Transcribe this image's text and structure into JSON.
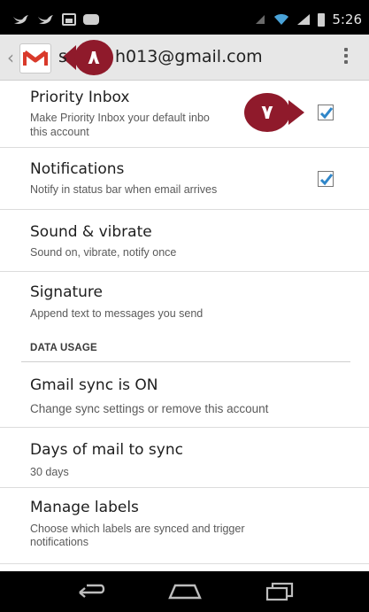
{
  "status_bar": {
    "time": "5:26",
    "icons": [
      "twitter-icon",
      "twitter-icon",
      "image-icon",
      "chat-icon",
      "signal-dim-icon",
      "wifi-icon",
      "cell-signal-icon",
      "battery-icon"
    ]
  },
  "header": {
    "account": "h013@gmail.com",
    "account_prefix": "s",
    "logo_letter": "M",
    "overflow_icon": "overflow-menu-icon"
  },
  "settings": {
    "priority_inbox": {
      "title": "Priority Inbox",
      "line1": "Make Priority Inbox your default inbo",
      "line2": "this account",
      "checked": true
    },
    "notifications": {
      "title": "Notifications",
      "subtitle": "Notify in status bar when email arrives",
      "checked": true
    },
    "sound": {
      "title": "Sound & vibrate",
      "subtitle": "Sound on, vibrate, notify once"
    },
    "signature": {
      "title": "Signature",
      "subtitle": "Append text to messages you send"
    },
    "data_usage_header": "DATA USAGE",
    "sync": {
      "title": "Gmail sync is ON",
      "subtitle": "Change sync settings or remove this account"
    },
    "days": {
      "title": "Days of mail to sync",
      "subtitle": "30 days"
    },
    "labels": {
      "title": "Manage labels",
      "line1": "Choose which labels are synced and trigger",
      "line2": "notifications"
    }
  },
  "annotations": {
    "badge_top": "٨",
    "badge_priority": "٧",
    "color": "#8f1a2b"
  },
  "navbar": {
    "icons": [
      "back-icon",
      "home-icon",
      "recent-apps-icon"
    ]
  }
}
